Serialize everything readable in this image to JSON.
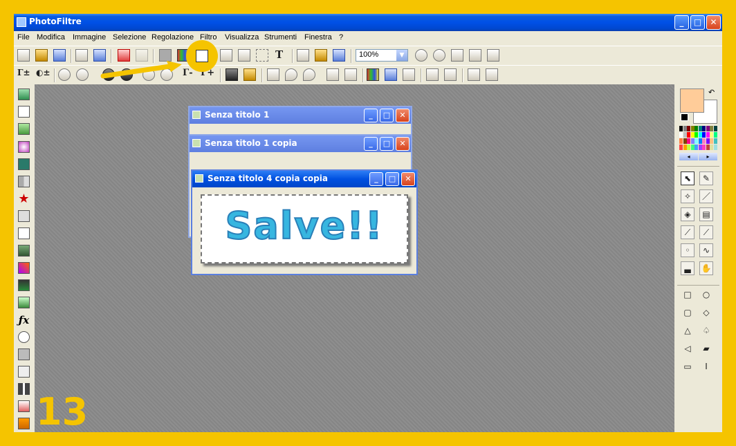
{
  "app": {
    "title": "PhotoFiltre",
    "min_glyph": "_",
    "max_glyph": "□",
    "close_glyph": "✕"
  },
  "menu": [
    "File",
    "Modifica",
    "Immagine",
    "Selezione",
    "Regolazione",
    "Filtro",
    "Visualizza",
    "Strumenti",
    "Finestra",
    "?"
  ],
  "toolbar": {
    "zoom_value": "100%",
    "zoom_arrow": "▼",
    "text_tool": "T"
  },
  "toolbar2": {
    "auto_contrast": "Γ±",
    "auto_levels": "◐±",
    "gamma_minus": "Γ-",
    "gamma_plus": "Γ+"
  },
  "documents": [
    {
      "title": "Senza titolo 1"
    },
    {
      "title": "Senza titolo 1 copia"
    },
    {
      "title": "Senza titolo 4 copia copia",
      "content": "Salve!!"
    }
  ],
  "annotation": {
    "step_number": "13"
  },
  "colors": {
    "frame": "#f5c400",
    "foreground": "#ffcc99",
    "background": "#ffffff",
    "title_bar": "#0050e6"
  },
  "palette": [
    "#000000",
    "#808080",
    "#800000",
    "#808000",
    "#008000",
    "#008080",
    "#000080",
    "#800080",
    "#808040",
    "#004040",
    "#ffffff",
    "#c0c0c0",
    "#ff0000",
    "#ffff00",
    "#00ff00",
    "#00ffff",
    "#0000ff",
    "#ff00ff",
    "#ffff80",
    "#00ff80",
    "#ff8040",
    "#804000",
    "#ff0080",
    "#8080ff",
    "#80ffff",
    "#0080ff",
    "#ff80c0",
    "#8000ff",
    "#ffc080",
    "#40c0c0",
    "#ff4040",
    "#ffa000",
    "#c0ff40",
    "#40ff80",
    "#40a0ff",
    "#a040ff",
    "#ff40c0",
    "#c04040",
    "#e0e0a0",
    "#a0e0e0"
  ],
  "right_tools": [
    "selection-arrow-icon",
    "eyedropper-icon",
    "magic-wand-icon",
    "line-icon",
    "fill-bucket-icon",
    "spray-icon",
    "brush-icon",
    "retouch-brush-icon",
    "blur-drop-icon",
    "smudge-finger-icon",
    "stamp-icon",
    "hand-icon"
  ],
  "shape_tools": [
    "rectangle-icon",
    "ellipse-icon",
    "rounded-rect-icon",
    "diamond-icon",
    "triangle-icon",
    "lasso-icon",
    "polygon-icon",
    "open-folder-icon",
    "horizontal-line-select-icon",
    "vertical-line-select-icon"
  ]
}
